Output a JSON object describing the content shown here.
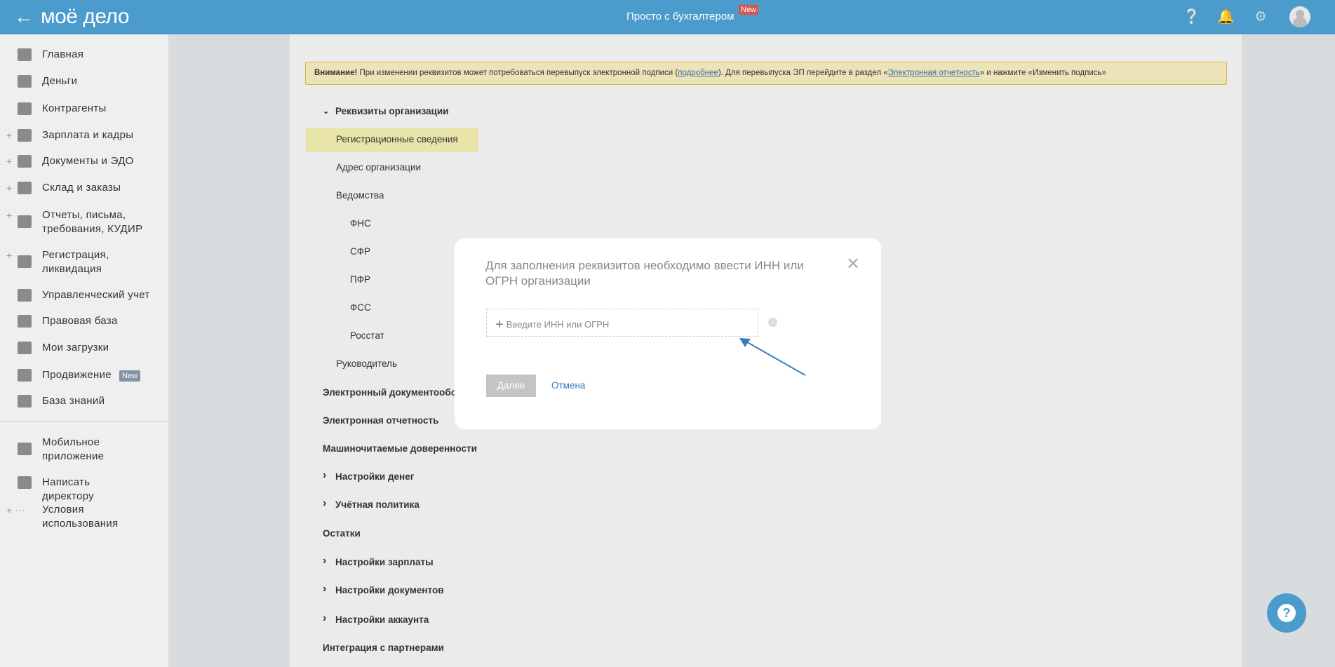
{
  "header": {
    "logo": "моё дело",
    "center_title": "Просто с бухгалтером",
    "center_badge": "New"
  },
  "sidebar": {
    "items": [
      {
        "label": "Главная",
        "plus": false
      },
      {
        "label": "Деньги",
        "plus": false
      },
      {
        "label": "Контрагенты",
        "plus": false
      },
      {
        "label": "Зарплата и кадры",
        "plus": true
      },
      {
        "label": "Документы и ЭДО",
        "plus": true
      },
      {
        "label": "Склад и заказы",
        "plus": true
      },
      {
        "label": "Отчеты, письма, требования, КУДИР",
        "plus": true
      },
      {
        "label": "Регистрация, ликвидация",
        "plus": true
      },
      {
        "label": "Управленческий учет",
        "plus": false
      },
      {
        "label": "Правовая база",
        "plus": false
      },
      {
        "label": "Мои загрузки",
        "plus": false
      },
      {
        "label": "Продвижение",
        "plus": false,
        "badge": "New"
      },
      {
        "label": "База знаний",
        "plus": false
      }
    ],
    "bottom": [
      {
        "label": "Мобильное приложение"
      },
      {
        "label": "Написать директору"
      },
      {
        "label": "Условия использования"
      }
    ]
  },
  "warning": {
    "bold": "Внимание!",
    "text1": " При изменении реквизитов может потребоваться перевыпуск электронной подписи (",
    "link1": "подробнее",
    "text2": "). Для перевыпуска ЭП перейдите в раздел «",
    "link2": "Электронная отчетность",
    "text3": "» и нажмите «Изменить подпись»"
  },
  "tree": [
    "Реквизиты организации",
    "Регистрационные сведения",
    "Адрес организации",
    "Ведомства",
    "ФНС",
    "СФР",
    "ПФР",
    "ФСС",
    "Росстат",
    "Руководитель",
    "Электронный документооборот",
    "Электронная отчетность",
    "Машиночитаемые доверенности",
    "Настройки денег",
    "Учётная политика",
    "Остатки",
    "Настройки зарплаты",
    "Настройки документов",
    "Настройки аккаунта",
    "Интеграция с партнерами"
  ],
  "modal": {
    "title": "Для заполнения реквизитов необходимо ввести ИНН или ОГРН организации",
    "input_placeholder": "Введите ИНН или ОГРН",
    "next": "Далее",
    "cancel": "Отмена"
  }
}
